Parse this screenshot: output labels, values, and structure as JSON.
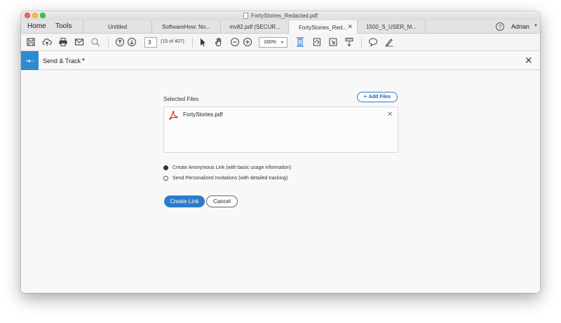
{
  "window": {
    "title": "FortyStories_Redacted.pdf"
  },
  "nav": {
    "home": "Home",
    "tools": "Tools"
  },
  "tabs": [
    {
      "label": "Untitled"
    },
    {
      "label": "SoftwareHow: No..."
    },
    {
      "label": "mv82.pdf (SECUR..."
    },
    {
      "label": "FortyStories_Red...",
      "active": true
    },
    {
      "label": "1500_S_USER_M..."
    }
  ],
  "account": {
    "help": "?",
    "user": "Adrian"
  },
  "toolbar": {
    "page_number": "3",
    "page_count": "(15 of 407)",
    "zoom": "160%"
  },
  "panel": {
    "title": "Send & Track",
    "close": "✕"
  },
  "send": {
    "selected_label": "Selected Files",
    "add_files": "Add Files",
    "add_files_plus": "+",
    "files": [
      {
        "name": "FortyStories.pdf",
        "remove": "✕"
      }
    ],
    "options": [
      {
        "label": "Create Anonymous Link (with basic usage information)",
        "checked": true
      },
      {
        "label": "Send Personalized Invitations (with detailed tracking)",
        "checked": false
      }
    ],
    "create_link": "Create Link",
    "cancel": "Cancel"
  },
  "colors": {
    "accent": "#2d7cc9",
    "panel_icon": "#2d8bd1",
    "pdf_red": "#d52b1e"
  }
}
